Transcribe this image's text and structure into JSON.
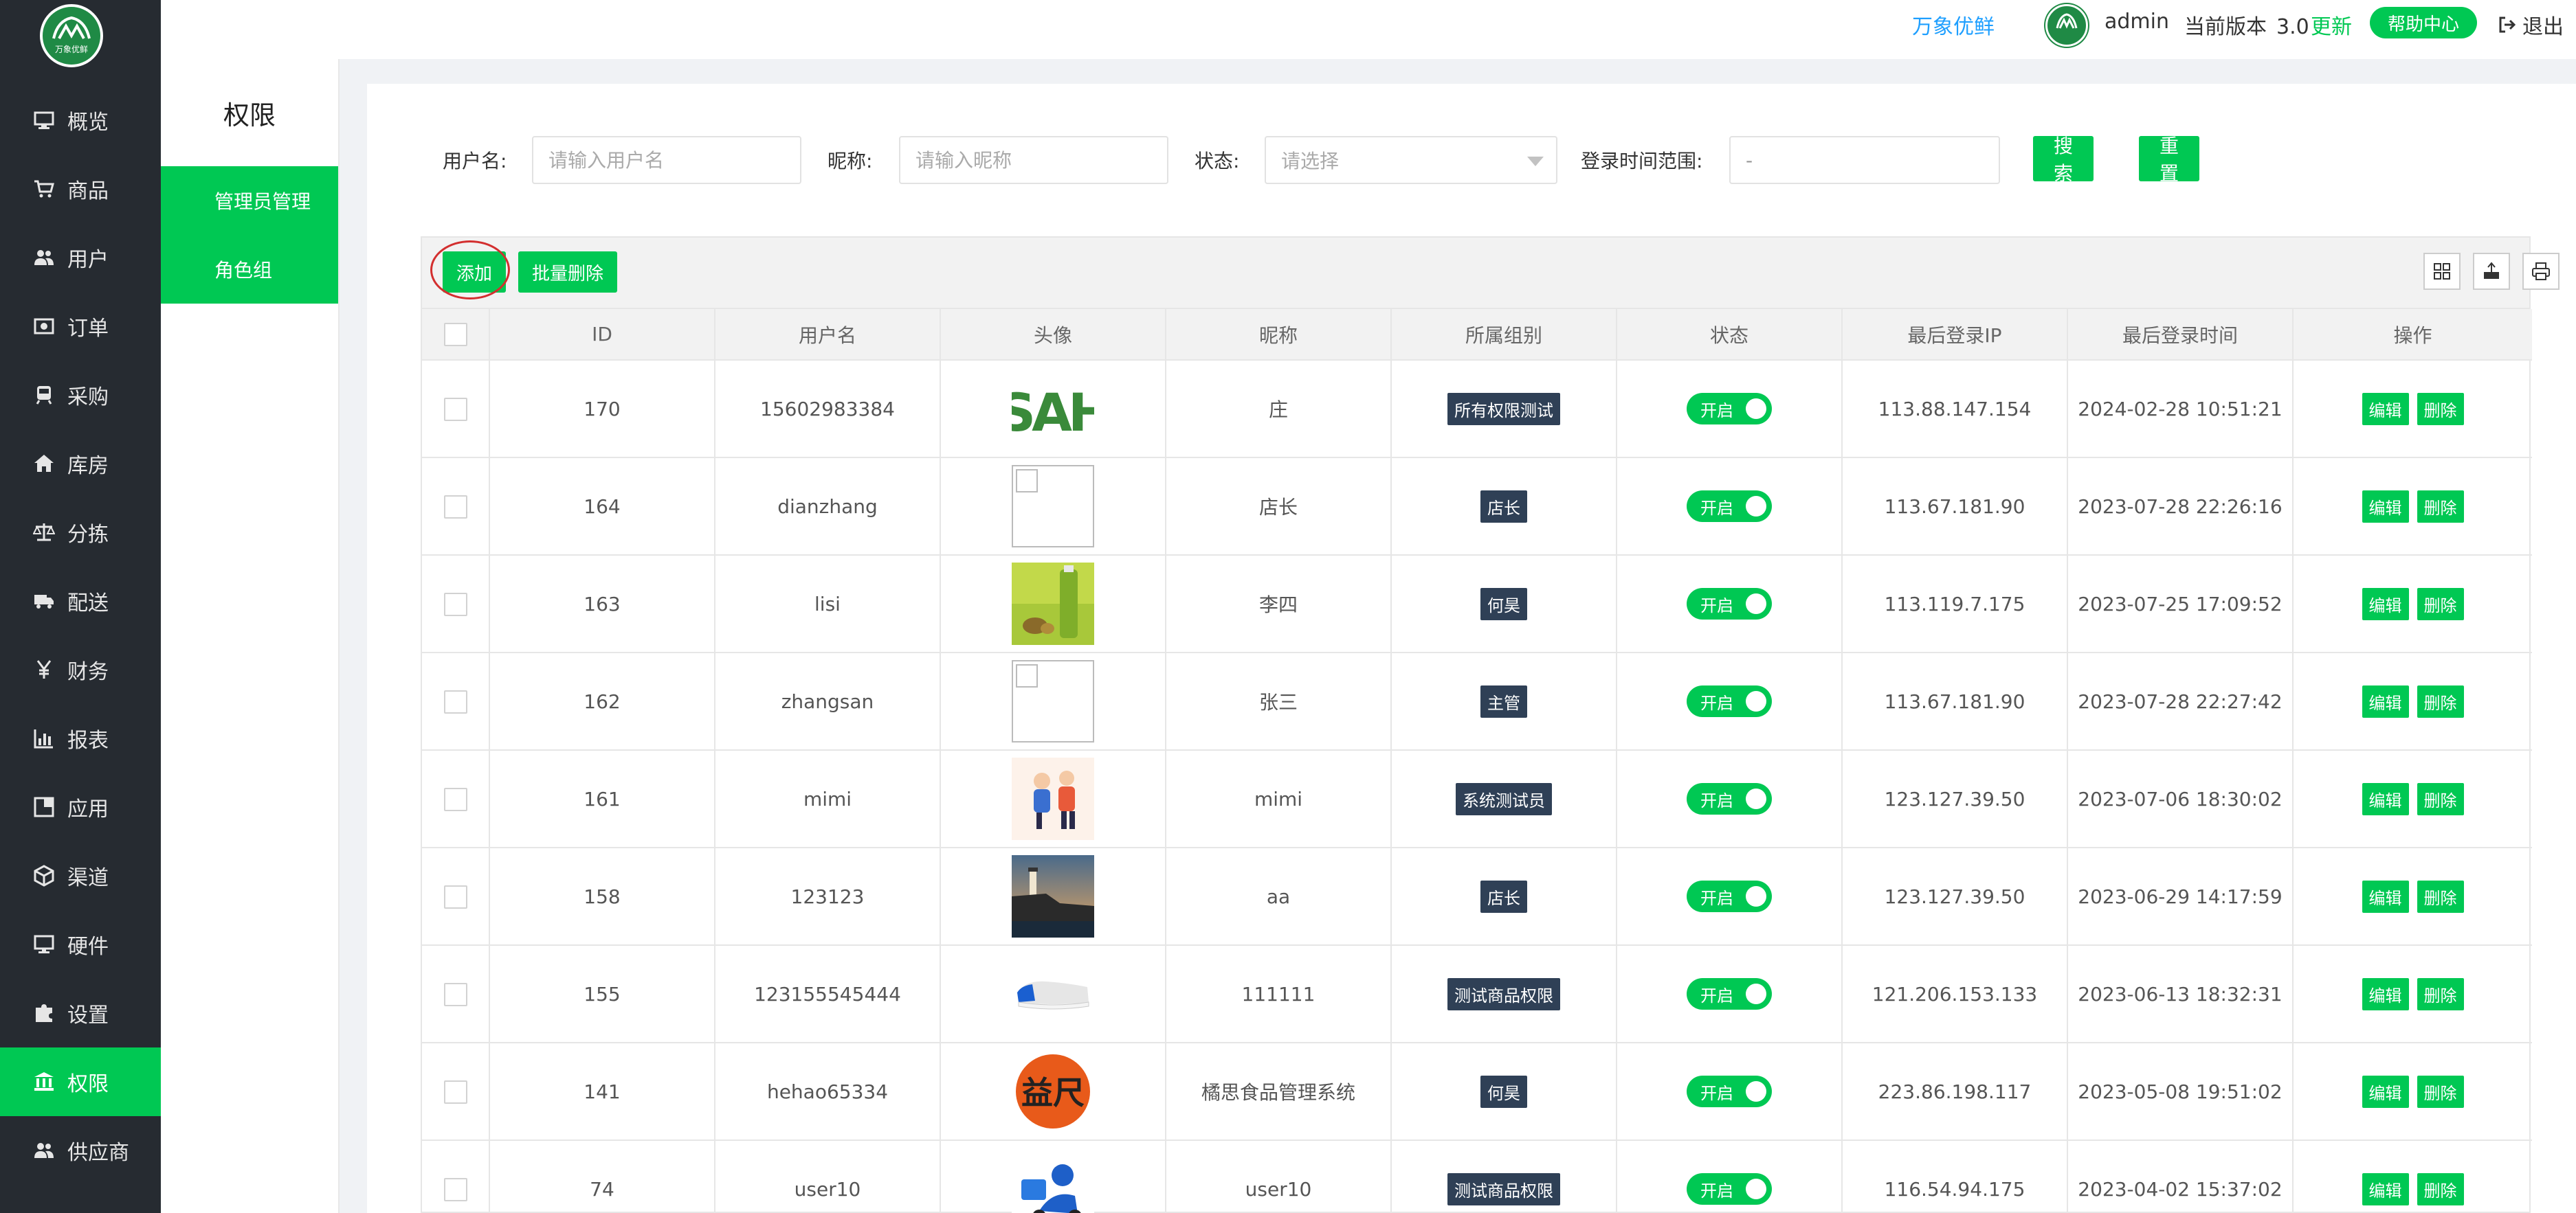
{
  "header": {
    "brand": "万象优鲜",
    "user": "admin",
    "version_label": "当前版本",
    "version": "3.0",
    "update": "更新",
    "help": "帮助中心",
    "logout": "退出"
  },
  "logo": {
    "text": "万象优鲜"
  },
  "sidebar": {
    "items": [
      {
        "label": "概览",
        "icon": "monitor-icon"
      },
      {
        "label": "商品",
        "icon": "cart-icon"
      },
      {
        "label": "用户",
        "icon": "users-icon"
      },
      {
        "label": "订单",
        "icon": "order-icon"
      },
      {
        "label": "采购",
        "icon": "train-icon"
      },
      {
        "label": "库房",
        "icon": "home-icon"
      },
      {
        "label": "分拣",
        "icon": "scale-icon"
      },
      {
        "label": "配送",
        "icon": "truck-icon"
      },
      {
        "label": "财务",
        "icon": "yen-icon"
      },
      {
        "label": "报表",
        "icon": "bar-chart-icon"
      },
      {
        "label": "应用",
        "icon": "apps-icon"
      },
      {
        "label": "渠道",
        "icon": "cube-icon"
      },
      {
        "label": "硬件",
        "icon": "desktop-icon"
      },
      {
        "label": "设置",
        "icon": "puzzle-icon"
      },
      {
        "label": "权限",
        "icon": "bank-icon"
      },
      {
        "label": "供应商",
        "icon": "users-icon"
      }
    ],
    "active_index": 14
  },
  "subnav": {
    "title": "权限",
    "items": [
      "管理员管理",
      "角色组"
    ]
  },
  "search": {
    "username_label": "用户名:",
    "username_placeholder": "请输入用户名",
    "nickname_label": "昵称:",
    "nickname_placeholder": "请输入昵称",
    "status_label": "状态:",
    "status_placeholder": "请选择",
    "time_label": "登录时间范围:",
    "time_value": "-",
    "search_btn": "搜索",
    "reset_btn": "重置"
  },
  "toolbar": {
    "add": "添加",
    "batch_delete": "批量删除"
  },
  "table": {
    "columns": [
      "ID",
      "用户名",
      "头像",
      "昵称",
      "所属组别",
      "状态",
      "最后登录IP",
      "最后登录时间",
      "操作"
    ],
    "status_on": "开启",
    "edit": "编辑",
    "delete": "删除",
    "rows": [
      {
        "id": "170",
        "username": "15602983384",
        "avatar": "sah-logo",
        "nickname": "庄",
        "group": "所有权限测试",
        "ip": "113.88.147.154",
        "time": "2024-02-28 10:51:21"
      },
      {
        "id": "164",
        "username": "dianzhang",
        "avatar": "broken",
        "nickname": "店长",
        "group": "店长",
        "ip": "113.67.181.90",
        "time": "2023-07-28 22:26:16"
      },
      {
        "id": "163",
        "username": "lisi",
        "avatar": "juice",
        "nickname": "李四",
        "group": "何昊",
        "ip": "113.119.7.175",
        "time": "2023-07-25 17:09:52"
      },
      {
        "id": "162",
        "username": "zhangsan",
        "avatar": "broken",
        "nickname": "张三",
        "group": "主管",
        "ip": "113.67.181.90",
        "time": "2023-07-28 22:27:42"
      },
      {
        "id": "161",
        "username": "mimi",
        "avatar": "cartoon",
        "nickname": "mimi",
        "group": "系统测试员",
        "ip": "123.127.39.50",
        "time": "2023-07-06 18:30:02"
      },
      {
        "id": "158",
        "username": "123123",
        "avatar": "lighthouse",
        "nickname": "aa",
        "group": "店长",
        "ip": "123.127.39.50",
        "time": "2023-06-29 14:17:59"
      },
      {
        "id": "155",
        "username": "123155545444",
        "avatar": "shoe",
        "nickname": "111111",
        "group": "测试商品权限",
        "ip": "121.206.153.133",
        "time": "2023-06-13 18:32:31"
      },
      {
        "id": "141",
        "username": "hehao65334",
        "avatar": "yixian-logo",
        "nickname": "橘思食品管理系统",
        "group": "何昊",
        "ip": "223.86.198.117",
        "time": "2023-05-08 19:51:02"
      },
      {
        "id": "74",
        "username": "user10",
        "avatar": "delivery",
        "nickname": "user10",
        "group": "测试商品权限",
        "ip": "116.54.94.175",
        "time": "2023-04-02 15:37:02"
      }
    ]
  },
  "colors": {
    "accent": "#00c853",
    "sidebar_bg": "#262b31",
    "tag_bg": "#2f4056",
    "link_blue": "#1e9fff"
  }
}
